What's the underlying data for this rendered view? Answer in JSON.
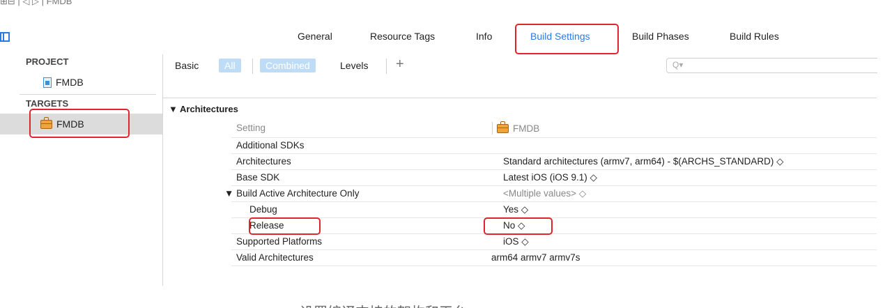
{
  "crumb": {
    "text": "⊞⊟ | ◁ ▷ | FMDB"
  },
  "tabs": [
    {
      "label": "General"
    },
    {
      "label": "Resource Tags"
    },
    {
      "label": "Info"
    },
    {
      "label": "Build Settings"
    },
    {
      "label": "Build Phases"
    },
    {
      "label": "Build Rules"
    }
  ],
  "sidebar": {
    "project_header": "PROJECT",
    "project_item": "FMDB",
    "targets_header": "TARGETS",
    "target_item": "FMDB"
  },
  "filter": {
    "basic": "Basic",
    "all": "All",
    "combined": "Combined",
    "levels": "Levels",
    "add": "+",
    "search_placeholder": "Q▾"
  },
  "settings": {
    "section": "▼ Architectures",
    "header_setting": "Setting",
    "header_target": "FMDB",
    "rows": [
      {
        "name": "Additional SDKs",
        "value": ""
      },
      {
        "name": "Architectures",
        "value": "Standard architectures (armv7, arm64)  -  $(ARCHS_STANDARD) ◇"
      },
      {
        "name": "Base SDK",
        "value": "Latest iOS (iOS 9.1) ◇"
      },
      {
        "name": "▼ Build Active Architecture Only",
        "value": "<Multiple values> ◇"
      },
      {
        "name": "Debug",
        "value": "Yes ◇"
      },
      {
        "name": "Release",
        "value": "No ◇"
      },
      {
        "name": "Supported Platforms",
        "value": "iOS ◇"
      },
      {
        "name": "Valid Architectures",
        "value": "arm64 armv7 armv7s"
      }
    ]
  },
  "caption": "设置编译支持的架构和平台",
  "colors": {
    "accent": "#2a7ae2",
    "highlight": "#e0242e",
    "pill": "#bfdcf6"
  }
}
